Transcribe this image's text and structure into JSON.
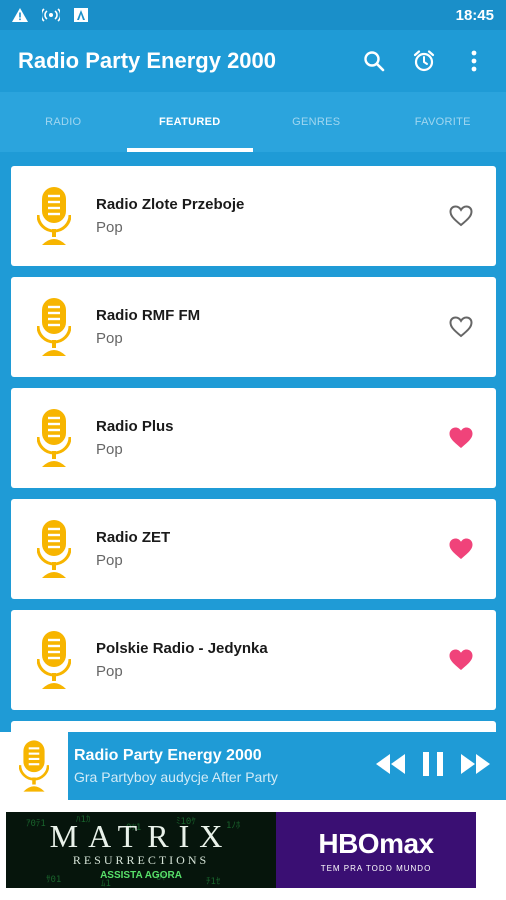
{
  "status_bar": {
    "time": "18:45"
  },
  "app": {
    "title": "Radio Party Energy 2000"
  },
  "tabs": [
    {
      "label": "RADIO",
      "active": false
    },
    {
      "label": "FEATURED",
      "active": true
    },
    {
      "label": "GENRES",
      "active": false
    },
    {
      "label": "FAVORITE",
      "active": false
    }
  ],
  "stations": [
    {
      "name": "Radio Zlote Przeboje",
      "genre": "Pop",
      "favorite": false
    },
    {
      "name": "Radio RMF FM",
      "genre": "Pop",
      "favorite": false
    },
    {
      "name": "Radio Plus",
      "genre": "Pop",
      "favorite": true
    },
    {
      "name": "Radio ZET",
      "genre": "Pop",
      "favorite": true
    },
    {
      "name": "Polskie Radio - Jedynka",
      "genre": "Pop",
      "favorite": true
    }
  ],
  "player": {
    "title": "Radio Party Energy 2000",
    "subtitle": "Gra Partyboy audycje After Party"
  },
  "ad": {
    "left_title": "MATRIX",
    "left_sub": "RESURRECTIONS",
    "left_cta": "ASSISTA AGORA",
    "right_brand": "HBOmax",
    "right_tagline": "TEM PRA TODO MUNDO"
  },
  "colors": {
    "primary": "#1f9bd6",
    "mic": "#f7b500",
    "heart_active": "#f0437a",
    "heart_inactive": "#666666"
  }
}
